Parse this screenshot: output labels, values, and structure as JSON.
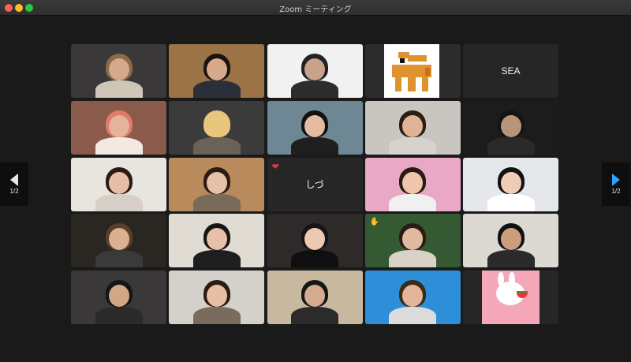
{
  "window": {
    "title": "Zoom ミーティング"
  },
  "navigation": {
    "prev_page": "1/2",
    "next_page": "1/2"
  },
  "tiles": [
    {
      "kind": "video",
      "bg": "#3a3838",
      "skin": "#d6a98a",
      "hair": "#8a6a4a",
      "shirt": "#cfc6b8"
    },
    {
      "kind": "video",
      "bg": "#9c7346",
      "skin": "#d7a98c",
      "hair": "#1a140f",
      "shirt": "#2a2f3a",
      "active": true
    },
    {
      "kind": "video",
      "bg": "#f1f1f1",
      "skin": "#caa18a",
      "hair": "#222",
      "shirt": "#2c2c2c"
    },
    {
      "kind": "avatar",
      "bg": "#2c2c2c"
    },
    {
      "kind": "name",
      "name": "SEA"
    },
    {
      "kind": "video",
      "bg": "#8a5a4a",
      "skin": "#e2b49a",
      "hair": "#e07a6a",
      "shirt": "#f3e9e1"
    },
    {
      "kind": "video",
      "bg": "#3b3b3b",
      "skin": "#e8c77c",
      "hair": "#e8c77c",
      "shirt": "#6a6256"
    },
    {
      "kind": "video",
      "bg": "#6e8794",
      "skin": "#e4bca2",
      "hair": "#111",
      "shirt": "#1f1f1f"
    },
    {
      "kind": "video",
      "bg": "#c9c5c0",
      "skin": "#e0b296",
      "hair": "#2a1d14",
      "shirt": "#d6d3cf"
    },
    {
      "kind": "video",
      "bg": "#1c1c1c",
      "skin": "#b89579",
      "hair": "#141414",
      "shirt": "#2a2a2a"
    },
    {
      "kind": "video",
      "bg": "#e8e4df",
      "skin": "#e7bea5",
      "hair": "#2b1a12",
      "shirt": "#d7cfc6"
    },
    {
      "kind": "video",
      "bg": "#b98a5c",
      "skin": "#e6c1a7",
      "hair": "#2a1c14",
      "shirt": "#7a6a5a"
    },
    {
      "kind": "name",
      "name": "しづ",
      "badge": "heart"
    },
    {
      "kind": "video",
      "bg": "#e9a9c6",
      "skin": "#efc5ad",
      "hair": "#2a1a12",
      "shirt": "#f0f0f0"
    },
    {
      "kind": "video",
      "bg": "#e6e7ea",
      "skin": "#f0cbb6",
      "hair": "#121212",
      "shirt": "#ffffff"
    },
    {
      "kind": "video",
      "bg": "#2a2622",
      "skin": "#d9b092",
      "hair": "#5a3e2a",
      "shirt": "#3a3a3a"
    },
    {
      "kind": "video",
      "bg": "#e0dbd3",
      "skin": "#e7c1a7",
      "hair": "#161616",
      "shirt": "#1e1e1e"
    },
    {
      "kind": "video",
      "bg": "#2e2a2a",
      "skin": "#efc8b1",
      "hair": "#151515",
      "shirt": "#0f0f0f"
    },
    {
      "kind": "video",
      "bg": "#355a33",
      "skin": "#e2b89e",
      "hair": "#2a1c13",
      "shirt": "#d9d2c8",
      "badge": "wave"
    },
    {
      "kind": "video",
      "bg": "#dcd8d2",
      "skin": "#cc9e7e",
      "hair": "#111",
      "shirt": "#2a2a2a"
    },
    {
      "kind": "video",
      "bg": "#3a3838",
      "skin": "#d3a785",
      "hair": "#151515",
      "shirt": "#2a2a2a"
    },
    {
      "kind": "video",
      "bg": "#d4d0ca",
      "skin": "#e6bfa4",
      "hair": "#2b1c12",
      "shirt": "#7a6c5c"
    },
    {
      "kind": "video",
      "bg": "#c8b8a0",
      "skin": "#d4ab8e",
      "hair": "#151515",
      "shirt": "#2b2b2b"
    },
    {
      "kind": "video",
      "bg": "#2e8fd8",
      "skin": "#e1b598",
      "hair": "#3a2a1c",
      "shirt": "#dcdcdc"
    },
    {
      "kind": "image",
      "bg": "#f4a7b8"
    }
  ]
}
